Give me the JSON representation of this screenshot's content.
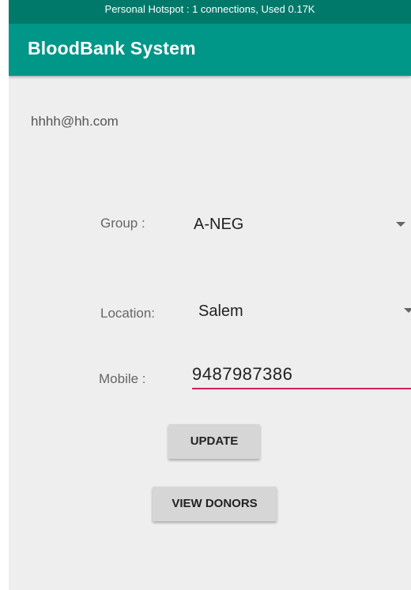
{
  "status_bar": {
    "text": "Personal Hotspot : 1 connections, Used 0.17K"
  },
  "app_bar": {
    "title": "BloodBank System"
  },
  "user": {
    "email": "hhhh@hh.com"
  },
  "form": {
    "group_label": "Group :",
    "group_value": "A-NEG",
    "location_label": "Location:",
    "location_value": "Salem",
    "mobile_label": "Mobile :",
    "mobile_value": "9487987386"
  },
  "buttons": {
    "update_label": "UPDATE",
    "view_donors_label": "VIEW DONORS"
  },
  "colors": {
    "status_bar": "#00796b",
    "app_bar": "#009688",
    "accent_underline": "#d81b60",
    "background": "#eeeeee"
  },
  "icons": {
    "spinner_caret": "caret-down-icon"
  }
}
